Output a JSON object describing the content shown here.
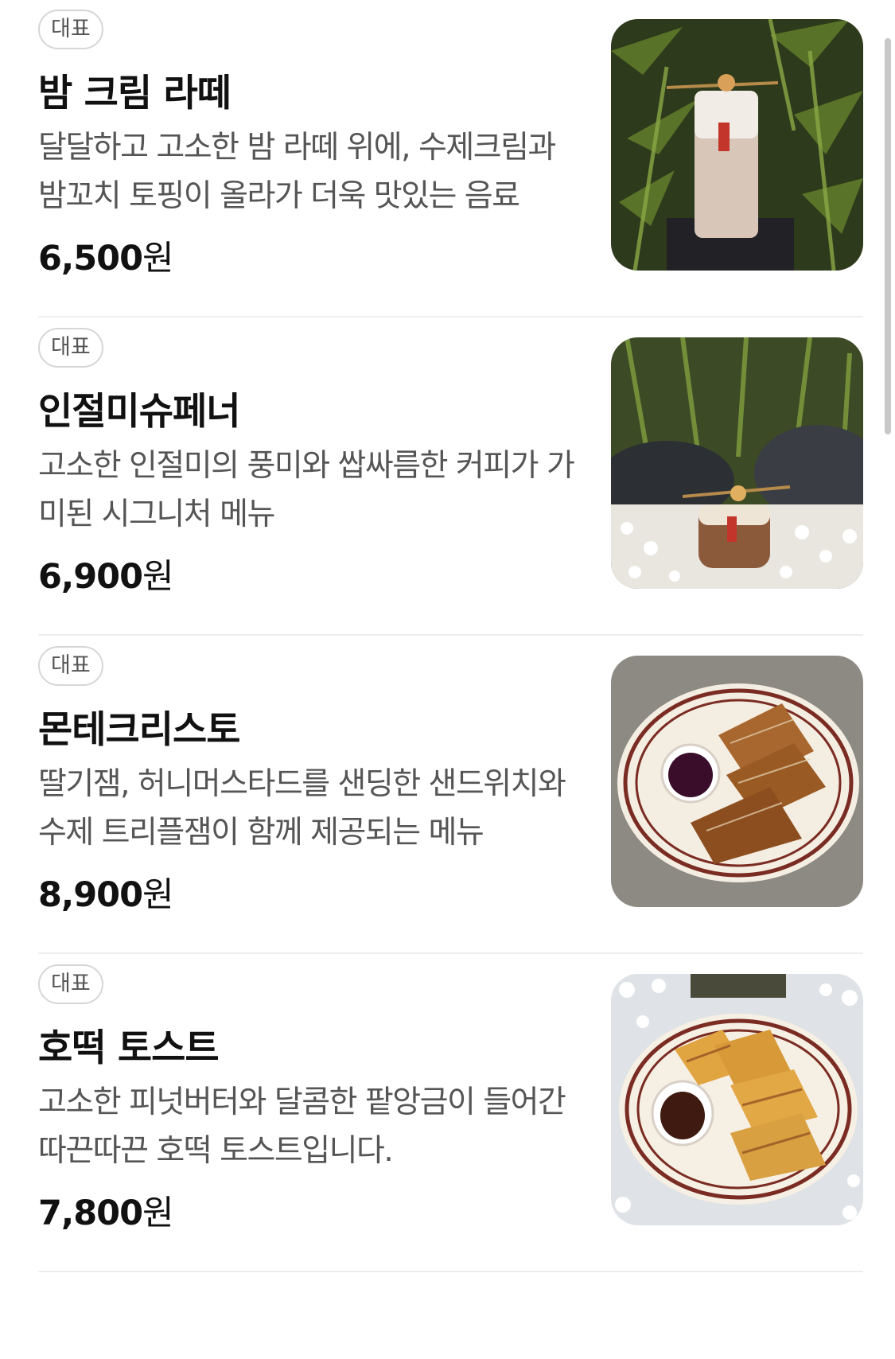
{
  "menu": {
    "items": [
      {
        "badge": "대표",
        "name": "밤 크림 라떼",
        "description": "달달하고 고소한 밤 라떼 위에, 수제크림과 밤꼬치 토핑이 올라가 더욱 맛있는 음료",
        "price": "6,500",
        "currency": "원",
        "image": "chestnut-cream-latte-photo"
      },
      {
        "badge": "대표",
        "name": "인절미슈페너",
        "description": "고소한 인절미의 풍미와 쌉싸름한 커피가 가미된 시그니처 메뉴",
        "price": "6,900",
        "currency": "원",
        "image": "injeolmi-einspanner-photo"
      },
      {
        "badge": "대표",
        "name": "몬테크리스토",
        "description": "딸기잼, 허니머스타드를 샌딩한 샌드위치와 수제 트리플잼이 함께 제공되는 메뉴",
        "price": "8,900",
        "currency": "원",
        "image": "monte-cristo-sandwich-photo"
      },
      {
        "badge": "대표",
        "name": "호떡 토스트",
        "description": "고소한 피넛버터와 달콤한 팥앙금이 들어간 따끈따끈 호떡 토스트입니다.",
        "price": "7,800",
        "currency": "원",
        "image": "hotteok-toast-photo"
      }
    ]
  },
  "colors": {
    "badge_border": "#d6d6d6",
    "text_primary": "#111111",
    "text_secondary": "#555555",
    "divider": "#eeeeee"
  }
}
